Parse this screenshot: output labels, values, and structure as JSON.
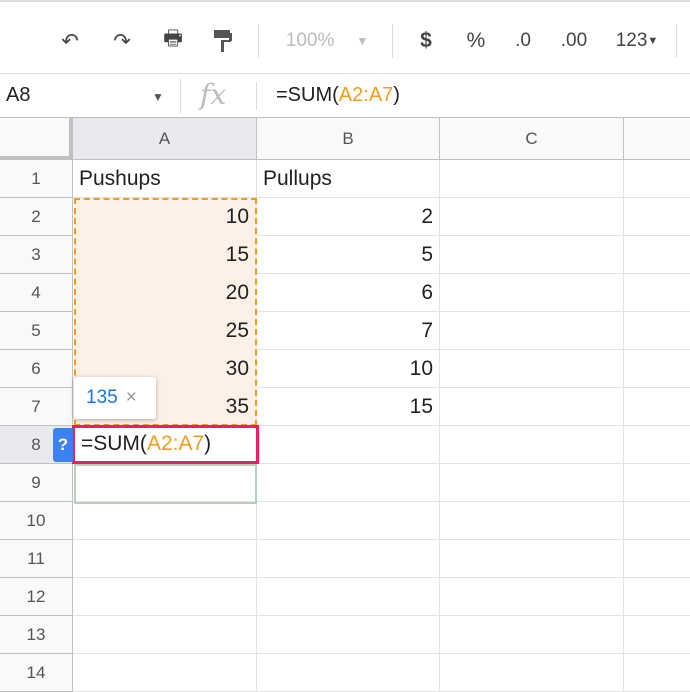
{
  "toolbar": {
    "zoom": "100%",
    "currency": "$",
    "percent": "%",
    "dec_decrease": ".0",
    "dec_increase": ".00",
    "format": "123"
  },
  "formula_bar": {
    "name_box": "A8",
    "fx": "fx",
    "formula_prefix": "=SUM(",
    "formula_range": "A2:A7",
    "formula_suffix": ")"
  },
  "columns": [
    "A",
    "B",
    "C"
  ],
  "rows": [
    "1",
    "2",
    "3",
    "4",
    "5",
    "6",
    "7",
    "8",
    "9",
    "10",
    "11",
    "12",
    "13",
    "14"
  ],
  "cells": {
    "A": [
      "Pushups",
      "10",
      "15",
      "20",
      "25",
      "30",
      "35"
    ],
    "B": [
      "Pullups",
      "2",
      "5",
      "6",
      "7",
      "10",
      "15"
    ]
  },
  "tooltip": {
    "value": "135",
    "close": "×"
  },
  "editor": {
    "help": "?",
    "prefix": "=SUM(",
    "range": "A2:A7",
    "suffix": ")"
  },
  "colors": {
    "accent_orange": "#f59a1b",
    "edit_border": "#e91e63",
    "range_fill": "#fdf0e6"
  }
}
